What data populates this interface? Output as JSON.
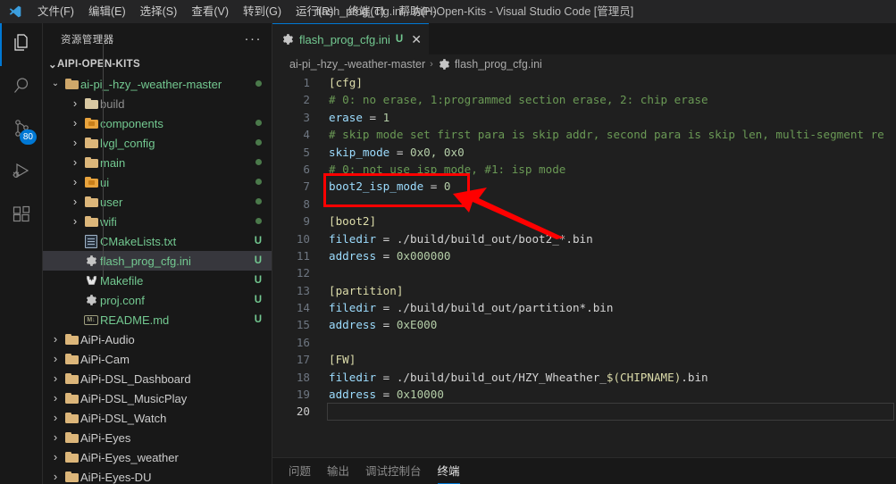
{
  "titlebar": {
    "logo_icon": "vscode-logo",
    "menu": [
      {
        "label": "文件(F)"
      },
      {
        "label": "编辑(E)"
      },
      {
        "label": "选择(S)"
      },
      {
        "label": "查看(V)"
      },
      {
        "label": "转到(G)"
      },
      {
        "label": "运行(R)"
      },
      {
        "label": "终端(T)"
      },
      {
        "label": "帮助(H)"
      }
    ],
    "window_title": "flash_prog_cfg.ini - AiPi-Open-Kits - Visual Studio Code [管理员]"
  },
  "activitybar": {
    "items": [
      {
        "name": "explorer",
        "icon": "files-icon",
        "active": true,
        "badge": ""
      },
      {
        "name": "search",
        "icon": "search-icon",
        "active": false,
        "badge": ""
      },
      {
        "name": "source-control",
        "icon": "source-control-icon",
        "active": false,
        "badge": "80"
      },
      {
        "name": "run-debug",
        "icon": "run-and-debug-icon",
        "active": false,
        "badge": ""
      },
      {
        "name": "extensions",
        "icon": "extensions-icon",
        "active": false,
        "badge": ""
      }
    ]
  },
  "sidebar": {
    "title": "资源管理器",
    "more_icon": "ellipsis-icon",
    "root_label": "AIPI-OPEN-KITS",
    "tree": [
      {
        "label": "ai-pi_-hzy_-weather-master",
        "indent": 1,
        "chev": "open",
        "icon": "folder-open",
        "color": "green",
        "status": "dot",
        "selected": false
      },
      {
        "label": "build",
        "indent": 2,
        "chev": "closed",
        "icon": "folder-light",
        "color": "grey",
        "status": "",
        "selected": false
      },
      {
        "label": "components",
        "indent": 2,
        "chev": "closed",
        "icon": "folder-pkg",
        "color": "green",
        "status": "dot",
        "selected": false
      },
      {
        "label": "lvgl_config",
        "indent": 2,
        "chev": "closed",
        "icon": "folder",
        "color": "green",
        "status": "dot",
        "selected": false
      },
      {
        "label": "main",
        "indent": 2,
        "chev": "closed",
        "icon": "folder",
        "color": "green",
        "status": "dot",
        "selected": false
      },
      {
        "label": "ui",
        "indent": 2,
        "chev": "closed",
        "icon": "folder-pkg",
        "color": "green",
        "status": "dot",
        "selected": false
      },
      {
        "label": "user",
        "indent": 2,
        "chev": "closed",
        "icon": "folder",
        "color": "green",
        "status": "dot",
        "selected": false
      },
      {
        "label": "wifi",
        "indent": 2,
        "chev": "closed",
        "icon": "folder",
        "color": "green",
        "status": "dot",
        "selected": false
      },
      {
        "label": "CMakeLists.txt",
        "indent": 2,
        "chev": "none",
        "icon": "text-file",
        "color": "green",
        "status": "U",
        "selected": false
      },
      {
        "label": "flash_prog_cfg.ini",
        "indent": 2,
        "chev": "none",
        "icon": "gear-file",
        "color": "green",
        "status": "U",
        "selected": true
      },
      {
        "label": "Makefile",
        "indent": 2,
        "chev": "none",
        "icon": "makefile",
        "color": "green",
        "status": "U",
        "selected": false
      },
      {
        "label": "proj.conf",
        "indent": 2,
        "chev": "none",
        "icon": "gear-file",
        "color": "green",
        "status": "U",
        "selected": false
      },
      {
        "label": "README.md",
        "indent": 2,
        "chev": "none",
        "icon": "markdown-file",
        "color": "green",
        "status": "U",
        "selected": false
      },
      {
        "label": "AiPi-Audio",
        "indent": 1,
        "chev": "closed",
        "icon": "folder",
        "color": "plain",
        "status": "",
        "selected": false
      },
      {
        "label": "AiPi-Cam",
        "indent": 1,
        "chev": "closed",
        "icon": "folder",
        "color": "plain",
        "status": "",
        "selected": false
      },
      {
        "label": "AiPi-DSL_Dashboard",
        "indent": 1,
        "chev": "closed",
        "icon": "folder",
        "color": "plain",
        "status": "",
        "selected": false
      },
      {
        "label": "AiPi-DSL_MusicPlay",
        "indent": 1,
        "chev": "closed",
        "icon": "folder",
        "color": "plain",
        "status": "",
        "selected": false
      },
      {
        "label": "AiPi-DSL_Watch",
        "indent": 1,
        "chev": "closed",
        "icon": "folder",
        "color": "plain",
        "status": "",
        "selected": false
      },
      {
        "label": "AiPi-Eyes",
        "indent": 1,
        "chev": "closed",
        "icon": "folder",
        "color": "plain",
        "status": "",
        "selected": false
      },
      {
        "label": "AiPi-Eyes_weather",
        "indent": 1,
        "chev": "closed",
        "icon": "folder",
        "color": "plain",
        "status": "",
        "selected": false
      },
      {
        "label": "AiPi-Eyes-DU",
        "indent": 1,
        "chev": "closed",
        "icon": "folder",
        "color": "plain",
        "status": "",
        "selected": false
      }
    ]
  },
  "editor": {
    "tab": {
      "icon": "gear-file-icon",
      "label": "flash_prog_cfg.ini",
      "unsaved_marker": "U",
      "close_icon": "close-icon"
    },
    "breadcrumb": {
      "folder": "ai-pi_-hzy_-weather-master",
      "separator": "›",
      "file_icon": "gear-file-icon",
      "file": "flash_prog_cfg.ini"
    },
    "lines": [
      {
        "n": "1",
        "tokens": [
          {
            "t": "[cfg]",
            "c": "c-sec"
          }
        ]
      },
      {
        "n": "2",
        "tokens": [
          {
            "t": "# 0: no erase, 1:programmed section erase, 2: chip erase",
            "c": "c-com"
          }
        ]
      },
      {
        "n": "3",
        "tokens": [
          {
            "t": "erase",
            "c": "c-key"
          },
          {
            "t": " = ",
            "c": "c-op"
          },
          {
            "t": "1",
            "c": "c-num"
          }
        ]
      },
      {
        "n": "4",
        "tokens": [
          {
            "t": "# skip mode set first para is skip addr, second para is skip len, multi-segment re",
            "c": "c-com"
          }
        ]
      },
      {
        "n": "5",
        "tokens": [
          {
            "t": "skip_mode",
            "c": "c-key"
          },
          {
            "t": " = ",
            "c": "c-op"
          },
          {
            "t": "0x0, 0x0",
            "c": "c-num"
          }
        ]
      },
      {
        "n": "6",
        "tokens": [
          {
            "t": "# 0: not use isp mode, #1: isp mode",
            "c": "c-com"
          }
        ]
      },
      {
        "n": "7",
        "tokens": [
          {
            "t": "boot2_isp_mode",
            "c": "c-key"
          },
          {
            "t": " = ",
            "c": "c-op"
          },
          {
            "t": "0",
            "c": "c-num"
          }
        ]
      },
      {
        "n": "8",
        "tokens": []
      },
      {
        "n": "9",
        "tokens": [
          {
            "t": "[boot2]",
            "c": "c-sec"
          }
        ]
      },
      {
        "n": "10",
        "tokens": [
          {
            "t": "filedir",
            "c": "c-key"
          },
          {
            "t": " = ",
            "c": "c-op"
          },
          {
            "t": "./build/build_out/boot2_*.bin",
            "c": "c-op"
          }
        ]
      },
      {
        "n": "11",
        "tokens": [
          {
            "t": "address",
            "c": "c-key"
          },
          {
            "t": " = ",
            "c": "c-op"
          },
          {
            "t": "0x000000",
            "c": "c-num"
          }
        ]
      },
      {
        "n": "12",
        "tokens": []
      },
      {
        "n": "13",
        "tokens": [
          {
            "t": "[partition]",
            "c": "c-sec"
          }
        ]
      },
      {
        "n": "14",
        "tokens": [
          {
            "t": "filedir",
            "c": "c-key"
          },
          {
            "t": " = ",
            "c": "c-op"
          },
          {
            "t": "./build/build_out/partition*.bin",
            "c": "c-op"
          }
        ]
      },
      {
        "n": "15",
        "tokens": [
          {
            "t": "address",
            "c": "c-key"
          },
          {
            "t": " = ",
            "c": "c-op"
          },
          {
            "t": "0xE000",
            "c": "c-num"
          }
        ]
      },
      {
        "n": "16",
        "tokens": []
      },
      {
        "n": "17",
        "tokens": [
          {
            "t": "[FW]",
            "c": "c-sec"
          }
        ]
      },
      {
        "n": "18",
        "tokens": [
          {
            "t": "filedir",
            "c": "c-key"
          },
          {
            "t": " = ",
            "c": "c-op"
          },
          {
            "t": "./build/build_out/HZY_Wheather_",
            "c": "c-op"
          },
          {
            "t": "$(CHIPNAME)",
            "c": "c-var"
          },
          {
            "t": ".bin",
            "c": "c-op"
          }
        ]
      },
      {
        "n": "19",
        "tokens": [
          {
            "t": "address",
            "c": "c-key"
          },
          {
            "t": " = ",
            "c": "c-op"
          },
          {
            "t": "0x10000",
            "c": "c-num"
          }
        ]
      },
      {
        "n": "20",
        "tokens": [],
        "current": true
      }
    ]
  },
  "annotation": {
    "color": "#ff0000",
    "box_target": "boot2_isp_mode = 0",
    "arrow": "arrow-pointing-up-left"
  },
  "panel": {
    "tabs": [
      {
        "label": "问题",
        "active": false
      },
      {
        "label": "输出",
        "active": false
      },
      {
        "label": "调试控制台",
        "active": false
      },
      {
        "label": "终端",
        "active": true
      }
    ]
  }
}
